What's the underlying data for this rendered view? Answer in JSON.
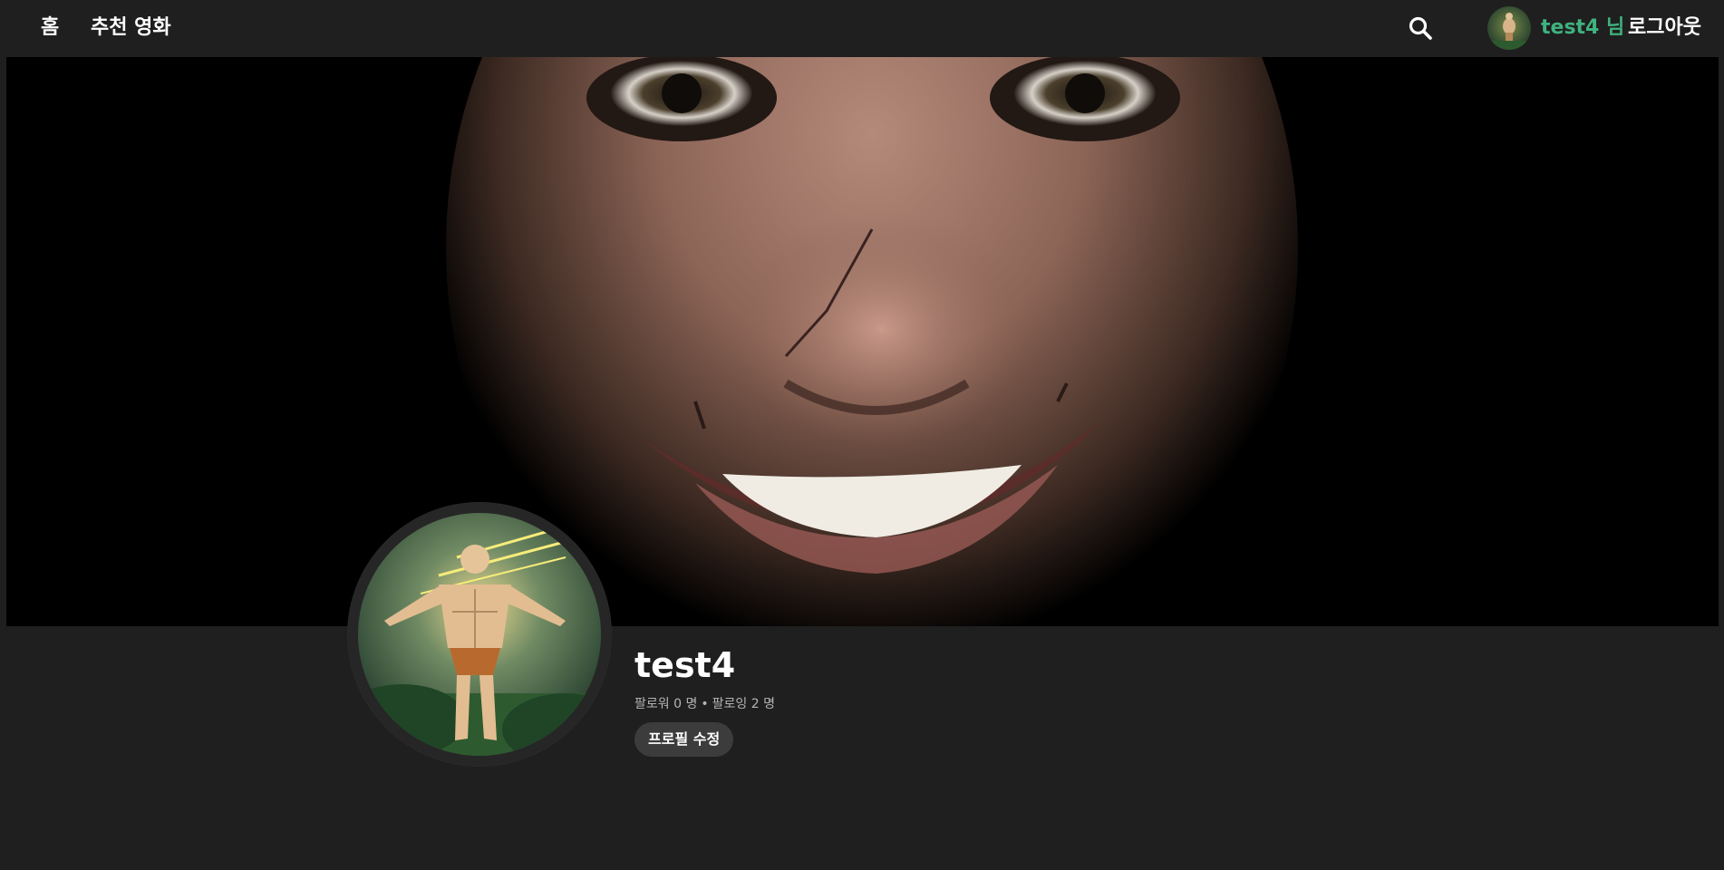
{
  "nav": {
    "home_label": "홈",
    "recommend_label": "추천 영화",
    "search_icon": "search-icon",
    "user_label": "test4 님",
    "logout_label": "로그아웃"
  },
  "profile": {
    "username": "test4",
    "follower_label": "팔로워",
    "follower_count": "0",
    "following_label": "팔로잉",
    "following_count": "2",
    "count_unit": "명",
    "separator": "•",
    "edit_button_label": "프로필 수정"
  },
  "colors": {
    "background": "#1f1f1f",
    "username_accent": "#3fb27f",
    "edit_button_bg": "#3c3c3c"
  }
}
